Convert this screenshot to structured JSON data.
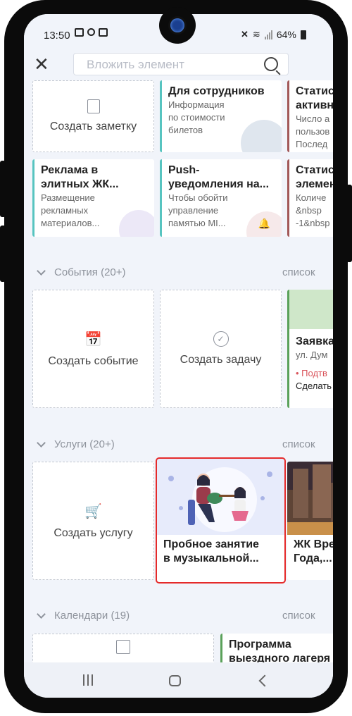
{
  "status": {
    "time": "13:50",
    "battery": "64%"
  },
  "search": {
    "placeholder": "Вложить элемент"
  },
  "notes_row1": {
    "create_note_label": "Создать заметку",
    "cards": [
      {
        "title": "Для сотрудников",
        "sub": "Информация\nпо стоимости\nбилетов"
      },
      {
        "title": "Статис\nактивн",
        "sub": "Число а\nпользов\nПослед"
      }
    ]
  },
  "notes_row2": {
    "cards": [
      {
        "title": "Реклама в\nэлитных ЖК...",
        "sub": "Размещение\nрекламных\nматериалов..."
      },
      {
        "title": "Push-\nуведомления на...",
        "sub": "Чтобы обойти\nуправление\nпамятью MI..."
      },
      {
        "title": "Статис\nэлемен",
        "sub": "Количе\n&nbsp\n-1&nbsp"
      }
    ]
  },
  "events": {
    "header": "События (20+)",
    "list_link": "список",
    "create_event_label": "Создать событие",
    "create_task_label": "Создать задачу",
    "card": {
      "title": "Заявка",
      "address": "ул. Дум",
      "status": "• Подтв",
      "action": "Сделать"
    }
  },
  "services": {
    "header": "Услуги (20+)",
    "list_link": "список",
    "create_service_label": "Создать услугу",
    "cards": [
      {
        "title": "Пробное занятие\nв музыкальной..."
      },
      {
        "title": "ЖК Вре\nГода,..."
      }
    ]
  },
  "calendars": {
    "header": "Календари (19)",
    "list_link": "список",
    "card": {
      "title": "Программа\nвыездного лагеря"
    }
  },
  "colors": {
    "accent_teal": "#57c4c0",
    "accent_brown": "#a25858",
    "accent_green": "#5aa15a",
    "selection": "#e52a2a"
  }
}
